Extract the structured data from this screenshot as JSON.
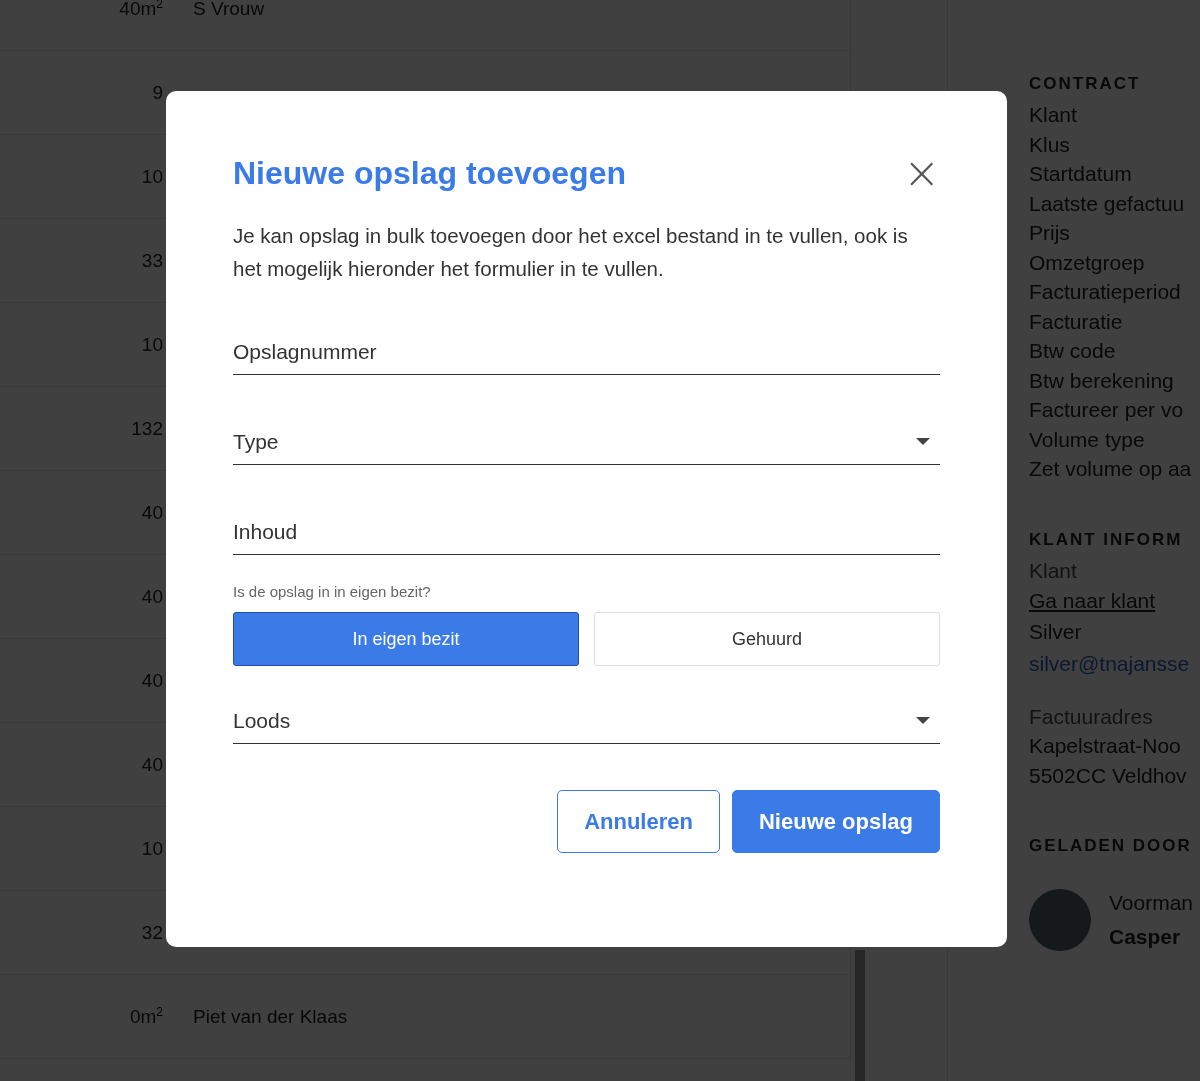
{
  "storage_list": {
    "rows": [
      {
        "size": "40m$^{2}$",
        "name": "S Vrouw"
      },
      {
        "size": "9"
      },
      {
        "size": "10"
      },
      {
        "size": "33"
      },
      {
        "size": "10"
      },
      {
        "size": "132"
      },
      {
        "size": "40"
      },
      {
        "size": "40"
      },
      {
        "size": "40"
      },
      {
        "size": "40"
      },
      {
        "size": "10"
      },
      {
        "size": "32"
      },
      {
        "size": "0m$^{2}$",
        "name": "Piet van der Klaas"
      }
    ]
  },
  "side_panel": {
    "sections": [
      {
        "heading": "CONTRACT",
        "items": [
          {
            "kind": "text",
            "text": "Klant"
          },
          {
            "kind": "text",
            "text": "Klus"
          },
          {
            "kind": "text",
            "text": "Startdatum"
          },
          {
            "kind": "text",
            "text": "Laatste gefactuu"
          },
          {
            "kind": "text",
            "text": "Prijs"
          },
          {
            "kind": "text",
            "text": "Omzetgroep"
          },
          {
            "kind": "text",
            "text": "Facturatieperiod"
          },
          {
            "kind": "text",
            "text": "Facturatie"
          },
          {
            "kind": "text",
            "text": "Btw code"
          },
          {
            "kind": "text",
            "text": "Btw berekening"
          },
          {
            "kind": "text",
            "text": "Factureer per vo"
          },
          {
            "kind": "text",
            "text": "Volume type"
          },
          {
            "kind": "text",
            "text": "Zet volume op aa"
          }
        ]
      },
      {
        "heading": "KLANT INFORM",
        "items": [
          {
            "kind": "label",
            "text": "Klant"
          },
          {
            "kind": "link",
            "text": "Ga naar klant"
          },
          {
            "kind": "text",
            "text": "Silver"
          },
          {
            "kind": "email",
            "text": "silver@tnajansse"
          },
          {
            "kind": "gap"
          },
          {
            "kind": "label",
            "text": "Factuuradres"
          },
          {
            "kind": "text",
            "text": "Kapelstraat-Noo"
          },
          {
            "kind": "text",
            "text": "5502CC Veldhov"
          }
        ]
      },
      {
        "heading": "GELADEN DOOR",
        "person": {
          "role": "Voorman",
          "name": "Casper"
        }
      }
    ]
  },
  "dialog": {
    "title": "Nieuwe opslag toevoegen",
    "close": "×",
    "description": "Je kan opslag in bulk toevoegen door het excel bestand in te vullen, ook is het mogelijk hieronder het formulier in te vullen.",
    "fields": [
      {
        "kind": "text",
        "placeholder": "Opslagnummer"
      },
      {
        "kind": "select",
        "placeholder": "Type"
      },
      {
        "kind": "text",
        "placeholder": "Inhoud"
      },
      {
        "kind": "choice",
        "question": "Is de opslag in in eigen bezit?",
        "options": [
          {
            "label": "In eigen bezit",
            "selected": true
          },
          {
            "label": "Gehuurd",
            "selected": false
          }
        ]
      },
      {
        "kind": "select",
        "placeholder": "Loods"
      }
    ],
    "buttons": [
      {
        "kind": "secondary",
        "label": "Annuleren"
      },
      {
        "kind": "primary",
        "label": "Nieuwe opslag"
      }
    ]
  }
}
